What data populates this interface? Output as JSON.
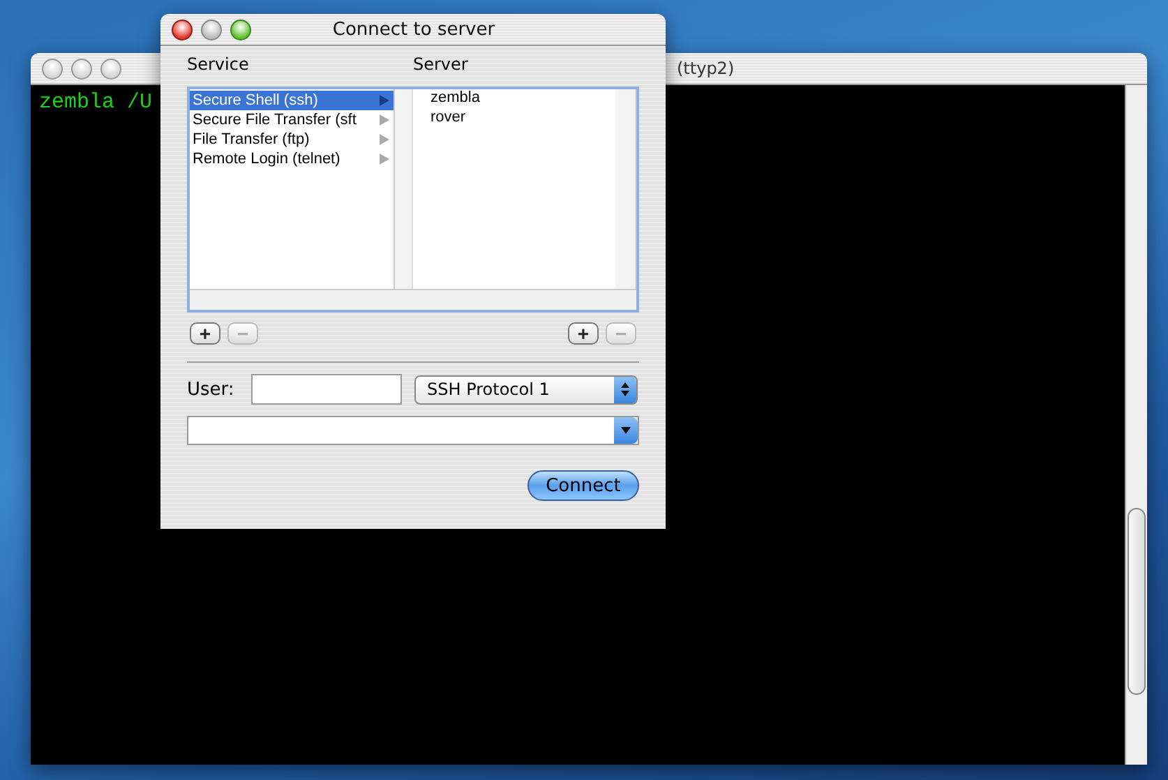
{
  "terminal": {
    "title": "(ttyp2)",
    "active": false,
    "lines": [
      "zembla /U"
    ]
  },
  "dialog": {
    "title": "Connect to server",
    "active": true,
    "service_header": "Service",
    "server_header": "Server",
    "services": [
      {
        "label": "Secure Shell (ssh)",
        "selected": true
      },
      {
        "label": "Secure File Transfer (sft",
        "selected": false
      },
      {
        "label": "File Transfer (ftp)",
        "selected": false
      },
      {
        "label": "Remote Login (telnet)",
        "selected": false
      }
    ],
    "servers": [
      {
        "label": "zembla",
        "selected": false
      },
      {
        "label": "rover",
        "selected": false
      }
    ],
    "service_buttons": [
      {
        "symbol": "+",
        "disabled": false
      },
      {
        "symbol": "−",
        "disabled": true
      }
    ],
    "server_buttons": [
      {
        "symbol": "+",
        "disabled": false
      },
      {
        "symbol": "−",
        "disabled": true
      }
    ],
    "user_label": "User:",
    "protocol": "SSH Protocol 1",
    "connect": "Connect"
  }
}
